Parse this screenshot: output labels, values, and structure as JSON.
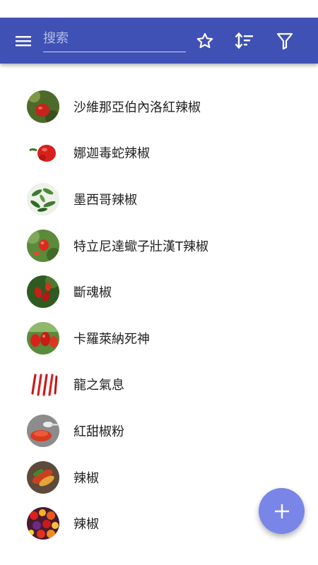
{
  "toolbar": {
    "background": "#3f51b5",
    "search_placeholder": "搜索",
    "search_value": "",
    "icons": [
      "menu-icon",
      "star-outline-icon",
      "sort-icon",
      "filter-icon"
    ]
  },
  "peppers": [
    {
      "label": "沙維那亞伯內洛紅辣椒",
      "icon": "pepper-thumbnail-icon"
    },
    {
      "label": "娜迦毒蛇辣椒",
      "icon": "pepper-thumbnail-icon"
    },
    {
      "label": "墨西哥辣椒",
      "icon": "pepper-thumbnail-icon"
    },
    {
      "label": "特立尼達蠍子壯漢T辣椒",
      "icon": "pepper-thumbnail-icon"
    },
    {
      "label": "斷魂椒",
      "icon": "pepper-thumbnail-icon"
    },
    {
      "label": "卡羅萊納死神",
      "icon": "pepper-thumbnail-icon"
    },
    {
      "label": "龍之氣息",
      "icon": "pepper-thumbnail-icon"
    },
    {
      "label": "紅甜椒粉",
      "icon": "pepper-thumbnail-icon"
    },
    {
      "label": "辣椒",
      "icon": "pepper-thumbnail-icon"
    },
    {
      "label": "辣椒",
      "icon": "pepper-thumbnail-icon"
    }
  ],
  "fab": {
    "icon": "plus-icon",
    "color": "#7986e8"
  }
}
